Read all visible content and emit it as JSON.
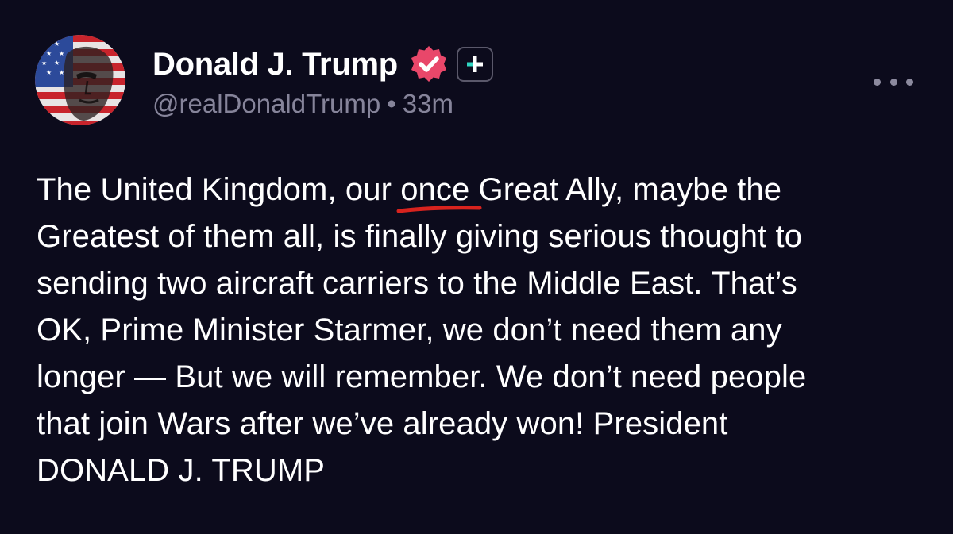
{
  "author": {
    "display_name": "Donald J. Trump",
    "handle": "@realDonaldTrump",
    "separator": "•",
    "time_ago": "33m"
  },
  "icons": {
    "verified": "verified-badge-icon",
    "plus_badge": "plus-badge-icon",
    "more": "more-options-icon",
    "avatar": "profile-avatar-flag-portrait"
  },
  "colors": {
    "background": "#0c0b1c",
    "verified_badge": "#e9476a",
    "plus_accent": "#2fd6c2",
    "secondary_text": "#86849a",
    "annotation_underline": "#d8231e"
  },
  "post": {
    "lines": [
      {
        "before": "The United Kingdom, our ",
        "underlined": "once",
        "after": " Great Ally, maybe the"
      },
      {
        "text": "Greatest of them all, is finally giving serious thought to"
      },
      {
        "text": "sending two aircraft carriers to the Middle East. That’s"
      },
      {
        "text": "OK, Prime Minister Starmer, we don’t need them any"
      },
      {
        "text": "longer — But we will remember. We don’t need people"
      },
      {
        "text": "that join Wars after we’ve already won! President"
      },
      {
        "text": "DONALD J. TRUMP"
      }
    ]
  }
}
